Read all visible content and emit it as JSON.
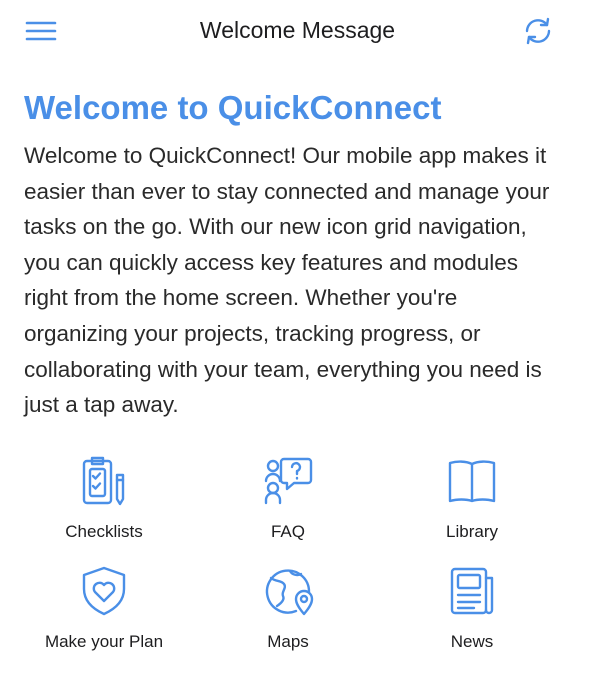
{
  "nav": {
    "title": "Welcome Message",
    "menu_icon": "hamburger-menu-icon",
    "refresh_icon": "refresh-icon"
  },
  "main": {
    "heading": "Welcome to QuickConnect",
    "body": "Welcome to QuickConnect! Our mobile app makes it easier than ever to stay connected and manage your tasks on the go. With our new icon grid navigation, you can quickly access key features and modules right from the home screen. Whether you're organizing your projects, tracking progress, or collaborating with your team, everything you need is just a tap away."
  },
  "grid": {
    "items": [
      {
        "label": "Checklists",
        "icon": "checklist-icon"
      },
      {
        "label": "FAQ",
        "icon": "faq-people-icon"
      },
      {
        "label": "Library",
        "icon": "book-icon"
      },
      {
        "label": "Make your Plan",
        "icon": "heart-shield-icon"
      },
      {
        "label": "Maps",
        "icon": "globe-pin-icon"
      },
      {
        "label": "News",
        "icon": "newspaper-icon"
      }
    ]
  },
  "colors": {
    "accent": "#4a8fe7",
    "text": "#1d1d1f"
  }
}
